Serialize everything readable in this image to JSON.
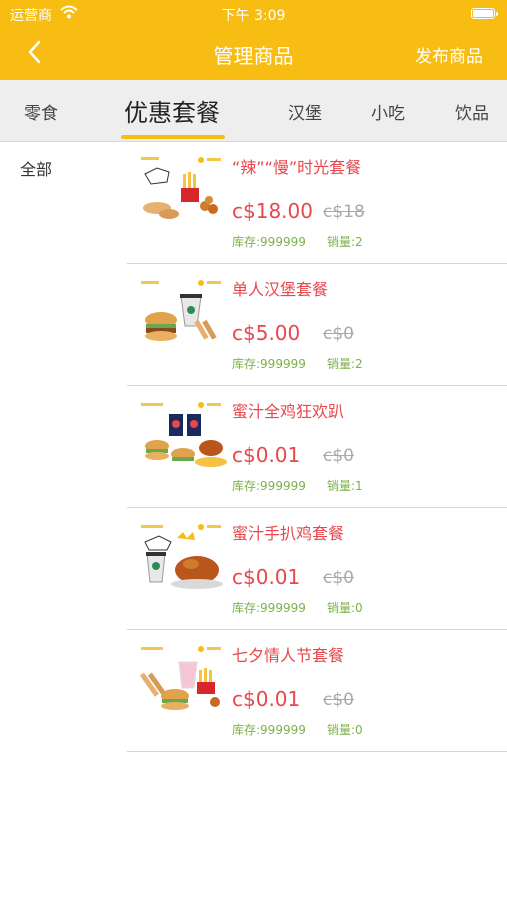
{
  "status_bar": {
    "carrier": "运营商",
    "time": "下午 3:09"
  },
  "nav": {
    "title": "管理商品",
    "publish_label": "发布商品"
  },
  "tabs": [
    {
      "label": "零食",
      "active": false
    },
    {
      "label": "优惠套餐",
      "active": true
    },
    {
      "label": "汉堡",
      "active": false
    },
    {
      "label": "小吃",
      "active": false
    },
    {
      "label": "饮品",
      "active": false
    }
  ],
  "sidebar": {
    "items": [
      {
        "label": "全部"
      }
    ]
  },
  "products": [
    {
      "name": "“辣”“慢”时光套餐",
      "price": "c$18.00",
      "old_price": "c$18",
      "stock": "库存:999999",
      "sales": "销量:2"
    },
    {
      "name": "单人汉堡套餐",
      "price": "c$5.00",
      "old_price": "c$0",
      "stock": "库存:999999",
      "sales": "销量:2"
    },
    {
      "name": "蜜汁全鸡狂欢趴",
      "price": "c$0.01",
      "old_price": "c$0",
      "stock": "库存:999999",
      "sales": "销量:1"
    },
    {
      "name": "蜜汁手扒鸡套餐",
      "price": "c$0.01",
      "old_price": "c$0",
      "stock": "库存:999999",
      "sales": "销量:0"
    },
    {
      "name": "七夕情人节套餐",
      "price": "c$0.01",
      "old_price": "c$0",
      "stock": "库存:999999",
      "sales": "销量:0"
    }
  ],
  "colors": {
    "brand": "#F8BD12",
    "price": "#E8474C",
    "meta": "#7CB14A",
    "tab_bg": "#EEEEEE"
  },
  "icons": {
    "back": "chevron-left-icon",
    "wifi": "wifi-icon",
    "battery": "battery-icon"
  }
}
